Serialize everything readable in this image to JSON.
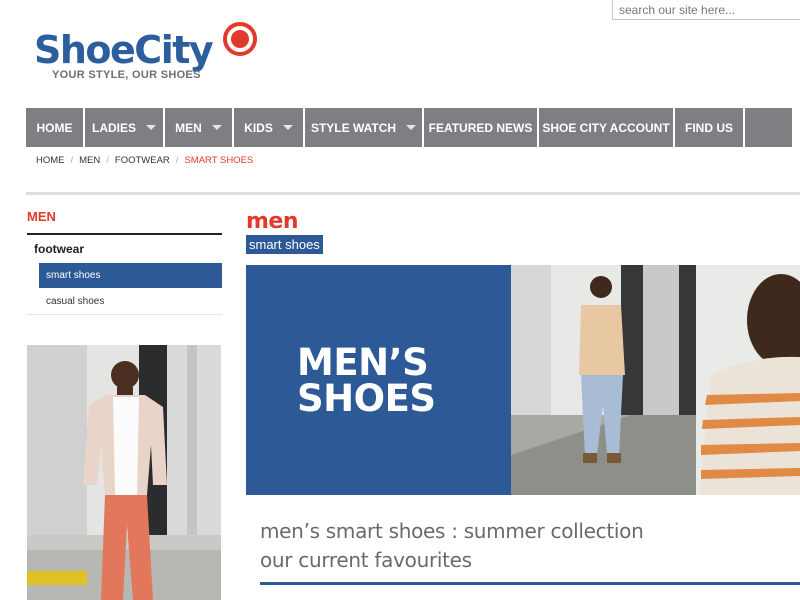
{
  "header": {
    "search_placeholder": "search our site here...",
    "logo_name": "ShoeCity",
    "logo_tagline": "YOUR STYLE, OUR SHOES",
    "brand_color": "#2c5d9c",
    "accent_color": "#e23a2a"
  },
  "nav": {
    "items": [
      {
        "label": "HOME",
        "dropdown": false
      },
      {
        "label": "LADIES",
        "dropdown": true
      },
      {
        "label": "MEN",
        "dropdown": true
      },
      {
        "label": "KIDS",
        "dropdown": true
      },
      {
        "label": "STYLE WATCH",
        "dropdown": true
      },
      {
        "label": "FEATURED NEWS",
        "dropdown": false
      },
      {
        "label": "SHOE CITY ACCOUNT",
        "dropdown": false
      },
      {
        "label": "FIND US",
        "dropdown": false
      }
    ]
  },
  "breadcrumb": {
    "items": [
      "HOME",
      "MEN",
      "FOOTWEAR",
      "SMART SHOES"
    ]
  },
  "sidebar": {
    "title": "MEN",
    "category": "footwear",
    "links": [
      {
        "label": "smart shoes",
        "active": true
      },
      {
        "label": "casual shoes",
        "active": false
      }
    ]
  },
  "main": {
    "title": "men",
    "subtitle": "smart shoes",
    "banner_text": "MEN’S SHOES",
    "headline": "men’s smart shoes : summer collection",
    "subheadline": "our current favourites"
  }
}
